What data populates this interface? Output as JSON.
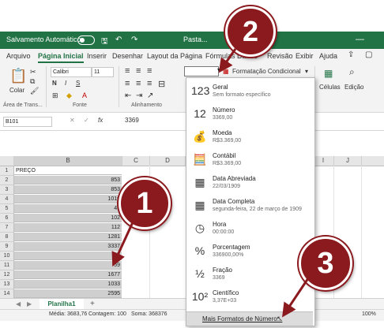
{
  "titlebar": {
    "autosave_label": "Salvamento Automático",
    "filename": "Pasta..."
  },
  "menu": {
    "tabs": [
      "Arquivo",
      "Página Inicial",
      "Inserir",
      "Desenhar",
      "Layout da Página",
      "Fórmulas",
      "Dados",
      "Revisão",
      "Exibir",
      "Ajuda"
    ]
  },
  "ribbon": {
    "paste_label": "Colar",
    "font_name": "Calibri",
    "font_size": "11",
    "bold": "N",
    "italic": "I",
    "underline": "S",
    "group_clipboard": "Área de Trans...",
    "group_font": "Fonte",
    "group_alignment": "Alinhamento",
    "conditional_format": "Formatação Condicional",
    "cells_label": "Células",
    "edit_label": "Edição"
  },
  "formula": {
    "cell_ref": "B101",
    "fx": "fx",
    "value": "3369"
  },
  "sheet": {
    "columns": [
      "B",
      "C",
      "D",
      "E",
      "F",
      "G",
      "H",
      "I",
      "J"
    ],
    "header": "PREÇO",
    "rows": [
      {
        "n": "1",
        "v": "PREÇO"
      },
      {
        "n": "2",
        "v": "853"
      },
      {
        "n": "3",
        "v": "853"
      },
      {
        "n": "4",
        "v": "1010"
      },
      {
        "n": "5",
        "v": "40"
      },
      {
        "n": "6",
        "v": "102"
      },
      {
        "n": "7",
        "v": "112"
      },
      {
        "n": "8",
        "v": "1281"
      },
      {
        "n": "9",
        "v": "3337"
      },
      {
        "n": "10",
        "v": "82"
      },
      {
        "n": "11",
        "v": "59"
      },
      {
        "n": "12",
        "v": "1677"
      },
      {
        "n": "13",
        "v": "1033"
      },
      {
        "n": "14",
        "v": "2595"
      }
    ]
  },
  "sheettab": {
    "name": "Planilha1",
    "add": "+"
  },
  "status": {
    "media": "Média: 3683,76",
    "contagem": "Contagem: 100",
    "soma": "Soma: 368376",
    "zoom": "100%"
  },
  "dropdown": {
    "items": [
      {
        "name": "Geral",
        "example": "Sem formato específico",
        "icon": "123"
      },
      {
        "name": "Número",
        "example": "3369,00",
        "icon": "12"
      },
      {
        "name": "Moeda",
        "example": "R$3.369,00",
        "icon": "💰"
      },
      {
        "name": "Contábil",
        "example": "R$3.369,00",
        "icon": "🧮"
      },
      {
        "name": "Data Abreviada",
        "example": "22/03/1909",
        "icon": "▦"
      },
      {
        "name": "Data Completa",
        "example": "segunda-feira, 22 de março de 1909",
        "icon": "▦"
      },
      {
        "name": "Hora",
        "example": "00:00:00",
        "icon": "◷"
      },
      {
        "name": "Porcentagem",
        "example": "336900,00%",
        "icon": "%"
      },
      {
        "name": "Fração",
        "example": "3369",
        "icon": "½"
      },
      {
        "name": "Científico",
        "example": "3,37E+03",
        "icon": "10²"
      }
    ],
    "more": "Mais Formatos de Número..."
  },
  "callouts": [
    "1",
    "2",
    "3"
  ],
  "colors": {
    "excel_green": "#217346",
    "callout": "#8b1a1f",
    "selection": "#cfcfcf"
  }
}
